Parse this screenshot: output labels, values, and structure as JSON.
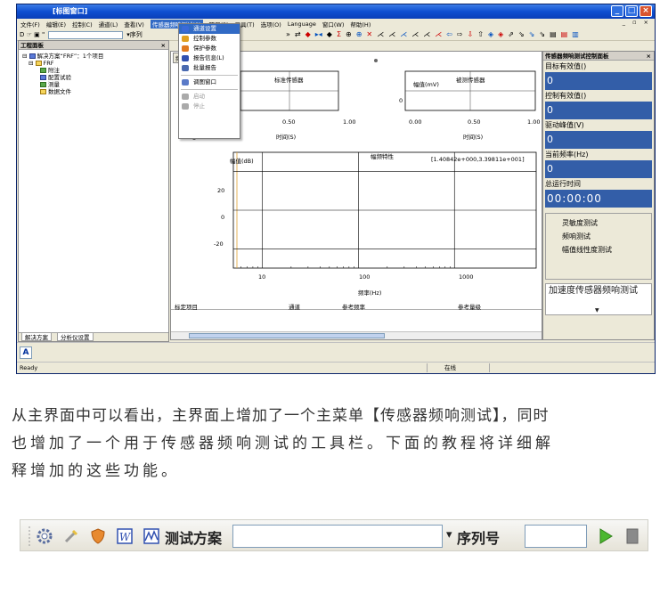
{
  "window": {
    "title": "[标图窗口]",
    "min": "_",
    "max": "□",
    "close": "×"
  },
  "menubar": {
    "items": [
      "文件(F)",
      "编辑(E)",
      "控制(C)",
      "通道(L)",
      "查看(V)",
      "传感器频响测试(S)",
      "项目(P)",
      "工具(T)",
      "选项(O)",
      "Language",
      "窗口(W)",
      "帮助(H)"
    ],
    "right_controls": "_ ▫ ×"
  },
  "toolbar": {
    "left_icons": "D ☞ ▣ \"",
    "combo_suffix": "▾序列",
    "glyphs": [
      "»",
      "⇄",
      "◆",
      "▸◂",
      "◆",
      "Σ",
      "⊕",
      "⊕",
      "✕",
      "⋌",
      "⋌",
      "⋌",
      "⋌",
      "⋌",
      "⋌",
      "⇦",
      "⇨",
      "⇩",
      "⇧",
      "◈",
      "◈",
      "⇗",
      "⇘",
      "⇘",
      "⇘",
      "▤",
      "▤",
      "▥"
    ]
  },
  "project_panel": {
    "title": "工程面板",
    "close": "×",
    "tree": [
      "解决方案“FRF”：1个项目",
      "FRF",
      "附注",
      "配置试验",
      "测量",
      "数据文件"
    ],
    "tabs": [
      "解决方案",
      "分析仪设置"
    ]
  },
  "dropdown": {
    "items": [
      {
        "label": "通道设置",
        "color": "#3a6ad8"
      },
      {
        "label": "控制参数",
        "color": "#e0a020"
      },
      {
        "label": "保护参数",
        "color": "#e07a20"
      },
      {
        "label": "报告信息(L)",
        "color": "#3050b0"
      },
      {
        "label": "批量报告",
        "color": "#4a6ab0"
      },
      {
        "label": "调图窗口",
        "color": "#5a7ac8"
      },
      {
        "label": "启动",
        "color": "#aaaaaa"
      },
      {
        "label": "停止",
        "color": "#aaaaaa"
      }
    ]
  },
  "center": {
    "tab_label": "频",
    "chart1": {
      "title": "标准传感器",
      "xticks": [
        "0.50",
        "1.00"
      ],
      "xlabel": "时间(S)"
    },
    "chart2": {
      "title": "被测传感器",
      "ylabel": "幅值(mV)",
      "ytick": "0",
      "xticks": [
        "0.00",
        "0.50",
        "1.00"
      ],
      "xlabel": "时间(S)"
    },
    "freq_chart": {
      "title": "幅频特性",
      "ylabel": "幅值(dB)",
      "range": "[1.40842e+000,3.39811e+001]",
      "yticks": [
        "20",
        "0",
        "-20"
      ],
      "xticks": [
        "10",
        "100",
        "1000"
      ],
      "xlabel": "频率(Hz)"
    },
    "table_headers": [
      "标定项目",
      "通道",
      "参考频率",
      "参考量级"
    ]
  },
  "control_panel": {
    "title": "传感器频响测试控制面板",
    "close": "×",
    "fields": [
      {
        "label": "目标有效值()",
        "value": "0"
      },
      {
        "label": "控制有效值()",
        "value": "0"
      },
      {
        "label": "驱动峰值(V)",
        "value": "0"
      },
      {
        "label": "当前频率(Hz)",
        "value": "0"
      },
      {
        "label": "总运行时间",
        "value": "00:00:00"
      }
    ],
    "buttons": [
      "灵敏度测试",
      "频响测试",
      "幅值线性度测试"
    ],
    "description": "加速度传感器频响测试"
  },
  "statusarea": {
    "a_button": "A"
  },
  "statusbar": {
    "left": "Ready",
    "right": "在线"
  },
  "paragraph": {
    "line1": "从主界面中可以看出，主界面上增加了一个主菜单【传感器频响测试】，同时",
    "line2": "也增加了一个用于传感器频响测试的工具栏。下面的教程将详细解",
    "line3": "释增加的这些功能。"
  },
  "toolbar2": {
    "scheme_label": "测试方案",
    "dropdown_arrow": "▾",
    "serial_label": "序列号"
  }
}
